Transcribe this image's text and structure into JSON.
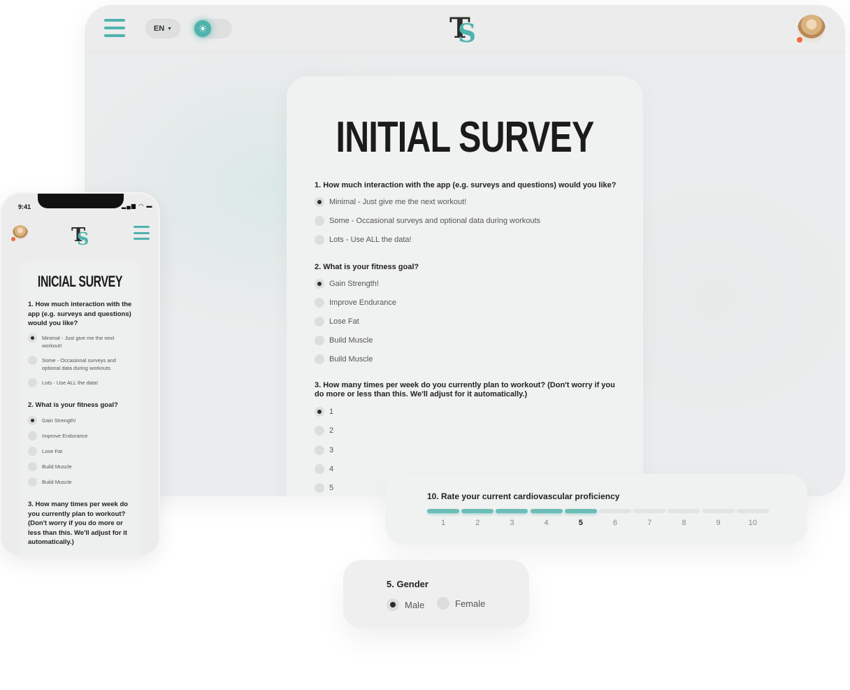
{
  "desktop": {
    "lang": "EN",
    "survey_title": "INITIAL SURVEY",
    "questions": [
      {
        "text": "1. How much interaction with the app (e.g. surveys and questions) would you like?",
        "options": [
          "Minimal - Just give me the next workout!",
          "Some - Occasional surveys and optional data during workouts",
          "Lots - Use ALL the data!"
        ],
        "selected": 0
      },
      {
        "text": "2. What is your fitness goal?",
        "options": [
          "Gain Strength!",
          "Improve Endurance",
          "Lose Fat",
          "Build Muscle",
          "Build Muscle"
        ],
        "selected": 0
      },
      {
        "text": "3. How many times per week do you currently plan to workout? (Don't worry if you do more or less than this. We'll adjust for it automatically.)",
        "options": [
          "1",
          "2",
          "3",
          "4",
          "5"
        ],
        "selected": 0
      }
    ]
  },
  "rating": {
    "title": "10. Rate your current cardiovascular proficiency",
    "scale": [
      "1",
      "2",
      "3",
      "4",
      "5",
      "6",
      "7",
      "8",
      "9",
      "10"
    ],
    "selected_value": 5
  },
  "gender": {
    "title": "5. Gender",
    "options": [
      "Male",
      "Female"
    ],
    "selected": 0
  },
  "phone": {
    "time": "9:41",
    "status_icons": "signal wifi battery",
    "survey_title": "INICIAL SURVEY",
    "questions": [
      {
        "text": "1. How much interaction with the app (e.g. surveys and questions) would you like?",
        "options": [
          "Minimal - Just give me the next workout!",
          "Some - Occasional surveys and optional data during workouts",
          "Lots - Use ALL the data!"
        ],
        "selected": 0
      },
      {
        "text": "2. What is your fitness goal?",
        "options": [
          "Gain Strength!",
          "Improve Endurance",
          "Lose Fat",
          "Build Muscle",
          "Build Muscle"
        ],
        "selected": 0
      },
      {
        "text": "3. How many times per week do you currently plan to workout? (Don't worry if you do more or less than this. We'll adjust for it automatically.)"
      }
    ]
  },
  "colors": {
    "accent": "#4fb3ad",
    "status_dot": "#f26b3a"
  }
}
